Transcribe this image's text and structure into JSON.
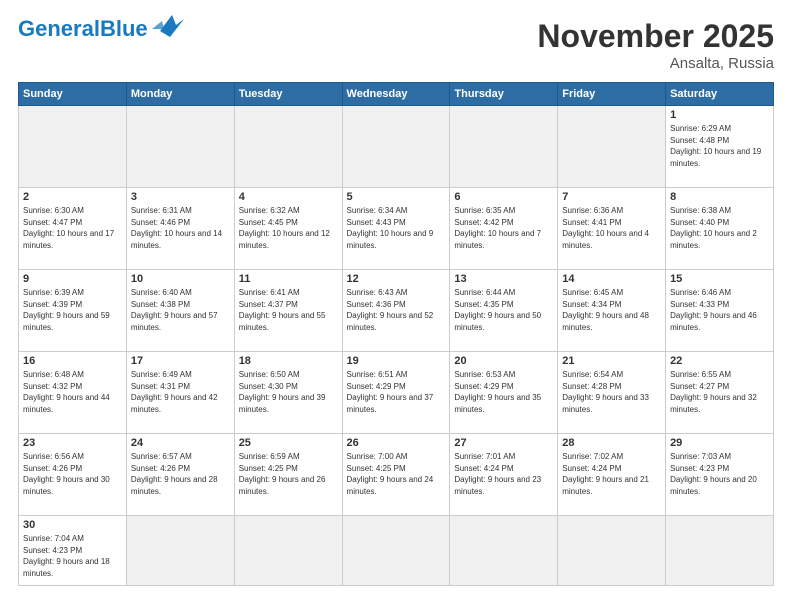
{
  "header": {
    "logo_general": "General",
    "logo_blue": "Blue",
    "month_title": "November 2025",
    "location": "Ansalta, Russia"
  },
  "weekdays": [
    "Sunday",
    "Monday",
    "Tuesday",
    "Wednesday",
    "Thursday",
    "Friday",
    "Saturday"
  ],
  "weeks": [
    [
      {
        "day": "",
        "empty": true
      },
      {
        "day": "",
        "empty": true
      },
      {
        "day": "",
        "empty": true
      },
      {
        "day": "",
        "empty": true
      },
      {
        "day": "",
        "empty": true
      },
      {
        "day": "",
        "empty": true
      },
      {
        "day": "1",
        "sunrise": "6:29 AM",
        "sunset": "4:48 PM",
        "daylight": "10 hours and 19 minutes."
      }
    ],
    [
      {
        "day": "2",
        "sunrise": "6:30 AM",
        "sunset": "4:47 PM",
        "daylight": "10 hours and 17 minutes."
      },
      {
        "day": "3",
        "sunrise": "6:31 AM",
        "sunset": "4:46 PM",
        "daylight": "10 hours and 14 minutes."
      },
      {
        "day": "4",
        "sunrise": "6:32 AM",
        "sunset": "4:45 PM",
        "daylight": "10 hours and 12 minutes."
      },
      {
        "day": "5",
        "sunrise": "6:34 AM",
        "sunset": "4:43 PM",
        "daylight": "10 hours and 9 minutes."
      },
      {
        "day": "6",
        "sunrise": "6:35 AM",
        "sunset": "4:42 PM",
        "daylight": "10 hours and 7 minutes."
      },
      {
        "day": "7",
        "sunrise": "6:36 AM",
        "sunset": "4:41 PM",
        "daylight": "10 hours and 4 minutes."
      },
      {
        "day": "8",
        "sunrise": "6:38 AM",
        "sunset": "4:40 PM",
        "daylight": "10 hours and 2 minutes."
      }
    ],
    [
      {
        "day": "9",
        "sunrise": "6:39 AM",
        "sunset": "4:39 PM",
        "daylight": "9 hours and 59 minutes."
      },
      {
        "day": "10",
        "sunrise": "6:40 AM",
        "sunset": "4:38 PM",
        "daylight": "9 hours and 57 minutes."
      },
      {
        "day": "11",
        "sunrise": "6:41 AM",
        "sunset": "4:37 PM",
        "daylight": "9 hours and 55 minutes."
      },
      {
        "day": "12",
        "sunrise": "6:43 AM",
        "sunset": "4:36 PM",
        "daylight": "9 hours and 52 minutes."
      },
      {
        "day": "13",
        "sunrise": "6:44 AM",
        "sunset": "4:35 PM",
        "daylight": "9 hours and 50 minutes."
      },
      {
        "day": "14",
        "sunrise": "6:45 AM",
        "sunset": "4:34 PM",
        "daylight": "9 hours and 48 minutes."
      },
      {
        "day": "15",
        "sunrise": "6:46 AM",
        "sunset": "4:33 PM",
        "daylight": "9 hours and 46 minutes."
      }
    ],
    [
      {
        "day": "16",
        "sunrise": "6:48 AM",
        "sunset": "4:32 PM",
        "daylight": "9 hours and 44 minutes."
      },
      {
        "day": "17",
        "sunrise": "6:49 AM",
        "sunset": "4:31 PM",
        "daylight": "9 hours and 42 minutes."
      },
      {
        "day": "18",
        "sunrise": "6:50 AM",
        "sunset": "4:30 PM",
        "daylight": "9 hours and 39 minutes."
      },
      {
        "day": "19",
        "sunrise": "6:51 AM",
        "sunset": "4:29 PM",
        "daylight": "9 hours and 37 minutes."
      },
      {
        "day": "20",
        "sunrise": "6:53 AM",
        "sunset": "4:29 PM",
        "daylight": "9 hours and 35 minutes."
      },
      {
        "day": "21",
        "sunrise": "6:54 AM",
        "sunset": "4:28 PM",
        "daylight": "9 hours and 33 minutes."
      },
      {
        "day": "22",
        "sunrise": "6:55 AM",
        "sunset": "4:27 PM",
        "daylight": "9 hours and 32 minutes."
      }
    ],
    [
      {
        "day": "23",
        "sunrise": "6:56 AM",
        "sunset": "4:26 PM",
        "daylight": "9 hours and 30 minutes."
      },
      {
        "day": "24",
        "sunrise": "6:57 AM",
        "sunset": "4:26 PM",
        "daylight": "9 hours and 28 minutes."
      },
      {
        "day": "25",
        "sunrise": "6:59 AM",
        "sunset": "4:25 PM",
        "daylight": "9 hours and 26 minutes."
      },
      {
        "day": "26",
        "sunrise": "7:00 AM",
        "sunset": "4:25 PM",
        "daylight": "9 hours and 24 minutes."
      },
      {
        "day": "27",
        "sunrise": "7:01 AM",
        "sunset": "4:24 PM",
        "daylight": "9 hours and 23 minutes."
      },
      {
        "day": "28",
        "sunrise": "7:02 AM",
        "sunset": "4:24 PM",
        "daylight": "9 hours and 21 minutes."
      },
      {
        "day": "29",
        "sunrise": "7:03 AM",
        "sunset": "4:23 PM",
        "daylight": "9 hours and 20 minutes."
      }
    ],
    [
      {
        "day": "30",
        "sunrise": "7:04 AM",
        "sunset": "4:23 PM",
        "daylight": "9 hours and 18 minutes."
      },
      {
        "day": "",
        "empty": true
      },
      {
        "day": "",
        "empty": true
      },
      {
        "day": "",
        "empty": true
      },
      {
        "day": "",
        "empty": true
      },
      {
        "day": "",
        "empty": true
      },
      {
        "day": "",
        "empty": true
      }
    ]
  ]
}
